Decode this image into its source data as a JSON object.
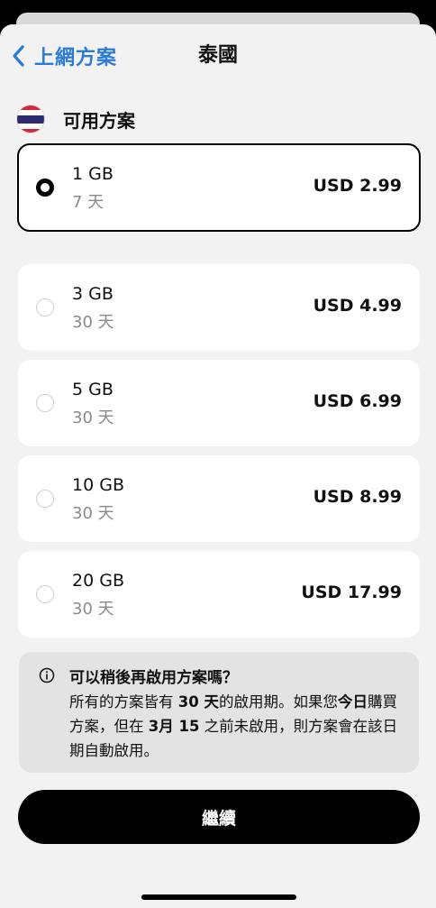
{
  "nav": {
    "back_label": "上網方案",
    "title": "泰國"
  },
  "section": {
    "title": "可用方案",
    "flag_icon": "thailand-flag-icon"
  },
  "plans": [
    {
      "data": "1 GB",
      "validity": "7 天",
      "price": "USD 2.99",
      "selected": true
    },
    {
      "data": "3 GB",
      "validity": "30 天",
      "price": "USD 4.99",
      "selected": false
    },
    {
      "data": "5 GB",
      "validity": "30 天",
      "price": "USD 6.99",
      "selected": false
    },
    {
      "data": "10 GB",
      "validity": "30 天",
      "price": "USD 8.99",
      "selected": false
    },
    {
      "data": "20 GB",
      "validity": "30 天",
      "price": "USD 17.99",
      "selected": false
    }
  ],
  "info": {
    "icon": "info-icon",
    "title": "可以稍後再啟用方案嗎？",
    "body_parts": [
      "所有的方案皆有 ",
      "30 天",
      "的啟用期。如果您",
      "今日",
      "購買方案，但在 ",
      "3月 15",
      " 之前未啟用，則方案會在該日期自動啟用。"
    ]
  },
  "cta": {
    "label": "繼續"
  },
  "colors": {
    "accent": "#2a7ad6",
    "selected_border": "#000000",
    "card_bg": "#ffffff",
    "info_bg": "#e3e3e3"
  }
}
